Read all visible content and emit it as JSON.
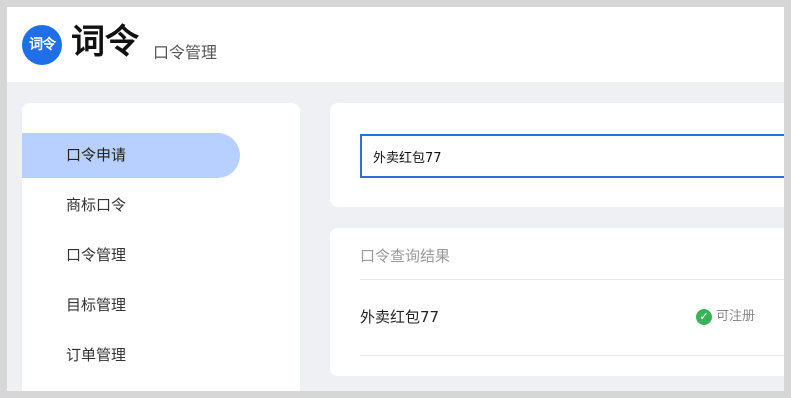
{
  "header": {
    "logo_text": "词令",
    "brand": "词令",
    "subtitle": "口令管理"
  },
  "sidebar": {
    "items": [
      {
        "label": "口令申请",
        "active": true
      },
      {
        "label": "商标口令",
        "active": false
      },
      {
        "label": "口令管理",
        "active": false
      },
      {
        "label": "目标管理",
        "active": false
      },
      {
        "label": "订单管理",
        "active": false
      }
    ]
  },
  "search": {
    "value": "外卖红包77"
  },
  "results": {
    "title": "口令查询结果",
    "items": [
      {
        "name": "外卖红包77",
        "status": "可注册",
        "status_icon": "check-circle-icon",
        "status_color": "#3bb15a"
      }
    ]
  },
  "colors": {
    "accent": "#1e6fe8",
    "active_menu_bg": "#b8d0ff",
    "input_border": "#2b6fd8"
  }
}
